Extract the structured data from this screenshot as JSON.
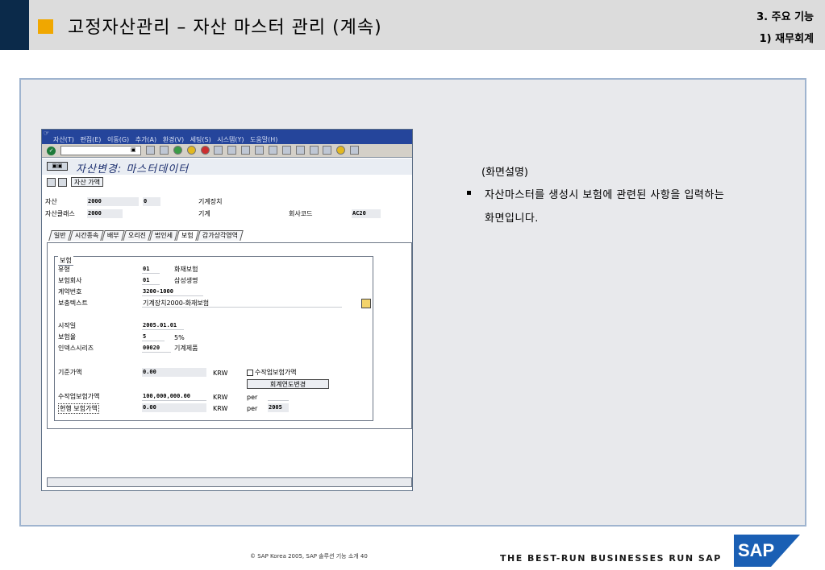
{
  "header": {
    "title": "고정자산관리 – 자산 마스터 관리 (계속)",
    "section": "3. 주요 기능",
    "subsection": "1) 재무회계"
  },
  "sap_window": {
    "menu": [
      "자산(T)",
      "편집(E)",
      "이동(G)",
      "추가(A)",
      "환경(V)",
      "세팅(S)",
      "시스템(Y)",
      "도움말(H)"
    ],
    "screen_title": "자산변경: 마스터데이터",
    "app_button": "자산 가액",
    "fields": {
      "asset_label": "자산",
      "asset_value": "2000",
      "asset_sub": "0",
      "asset_desc": "기계장치",
      "class_label": "자산클래스",
      "class_value": "2000",
      "class_desc": "기계",
      "company_label": "회사코드",
      "company_value": "AC20"
    },
    "tabs": [
      "일반",
      "시간종속",
      "배부",
      "오리진",
      "법인세",
      "보험",
      "감가상각영역"
    ],
    "active_tab": "보험",
    "insurance": {
      "group_title": "보험",
      "type_label": "유형",
      "type_code": "01",
      "type_text": "화재보험",
      "company_label": "보험회사",
      "company_code": "01",
      "company_text": "삼성생명",
      "contract_label": "계약번호",
      "contract_value": "3200-1000",
      "supp_text_label": "보충텍스트",
      "supp_text_value": "기계장치2000-화재보험",
      "start_label": "시작일",
      "start_value": "2005.01.01",
      "rate_label": "보험율",
      "rate_value": "5",
      "rate_pct": "5%",
      "index_label": "인덱스시리즈",
      "index_value": "00020",
      "index_text": "기계제품",
      "base_label": "기준가액",
      "base_value": "0.00",
      "base_curr": "KRW",
      "manual_check_label": "수작업보험가액",
      "fy_change_button": "회계연도변경",
      "manual_label": "수작업보험가액",
      "manual_value": "100,000,000.00",
      "manual_curr": "KRW",
      "manual_per": "per",
      "current_label": "현행 보험가액",
      "current_value": "0.00",
      "current_curr": "KRW",
      "current_per": "per",
      "current_year": "2005"
    }
  },
  "description": {
    "heading": "(화면설명)",
    "line1": "자산마스터를 생성시 보험에 관련된 사항을 입력하는",
    "line2": "화면입니다."
  },
  "footer": {
    "copyright": "© SAP Korea 2005, SAP 솔루션 기능 소개 40",
    "tagline": "THE BEST-RUN BUSINESSES RUN SAP",
    "logo_text": "SAP"
  },
  "colors": {
    "navy": "#0b2a4a",
    "orange": "#f0a700",
    "sap_blue": "#1a5fb4",
    "menubar": "#25459b"
  }
}
